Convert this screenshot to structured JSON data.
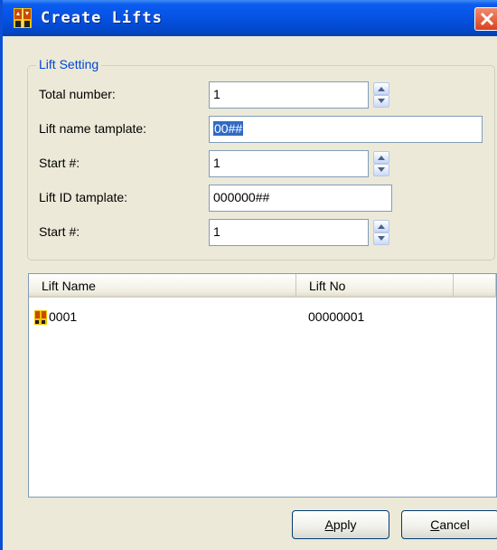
{
  "window": {
    "title": "Create Lifts",
    "colors": {
      "titlebar": "#0550e0",
      "legend": "#0046d5",
      "selection": "#316ac5",
      "close": "#d9421c"
    }
  },
  "lift_setting": {
    "legend": "Lift Setting",
    "total_number": {
      "label": "Total number:",
      "value": "1"
    },
    "lift_name_template": {
      "label": "Lift name tamplate:",
      "value": "00##"
    },
    "name_start": {
      "label": "Start #:",
      "value": "1"
    },
    "lift_id_template": {
      "label": "Lift ID tamplate:",
      "value": "000000##"
    },
    "id_start": {
      "label": "Start #:",
      "value": "1"
    }
  },
  "list": {
    "columns": [
      "Lift Name",
      "Lift No"
    ],
    "rows": [
      {
        "name": "0001",
        "no": "00000001",
        "icon": "lift-icon"
      }
    ]
  },
  "buttons": {
    "apply": {
      "accel": "A",
      "rest": "pply"
    },
    "cancel": {
      "accel": "C",
      "rest": "ancel"
    }
  }
}
